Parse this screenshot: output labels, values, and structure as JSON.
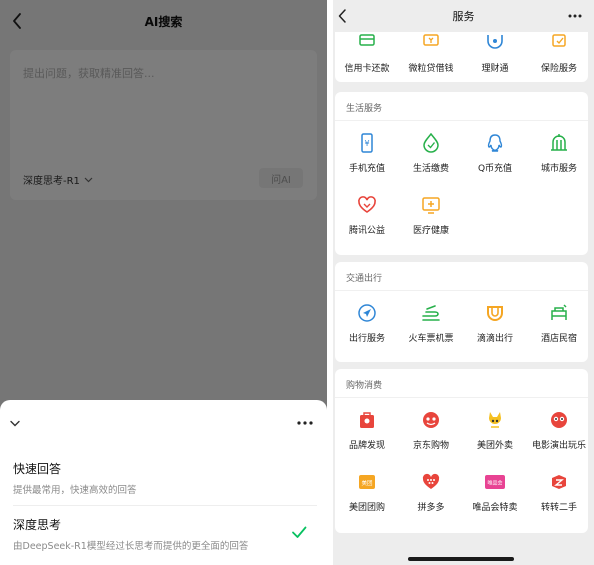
{
  "left": {
    "title": "AI搜索",
    "input_placeholder": "提出问题，获取精准回答...",
    "model_label": "深度思考-R1",
    "ask_button": "问AI",
    "sheet": {
      "options": [
        {
          "title": "快速回答",
          "desc": "提供最常用，快速高效的回答",
          "selected": false
        },
        {
          "title": "深度思考",
          "desc": "由DeepSeek-R1模型经过长思考而提供的更全面的回答",
          "selected": true
        }
      ]
    }
  },
  "right": {
    "title": "服务",
    "top_row": [
      {
        "label": "信用卡还款",
        "icon": "credit-card-icon"
      },
      {
        "label": "微粒贷借钱",
        "icon": "loan-icon"
      },
      {
        "label": "理财通",
        "icon": "wealth-icon"
      },
      {
        "label": "保险服务",
        "icon": "insurance-icon"
      }
    ],
    "sections": [
      {
        "title": "生活服务",
        "items": [
          {
            "label": "手机充值",
            "icon": "phone-recharge-icon"
          },
          {
            "label": "生活缴费",
            "icon": "utility-payment-icon"
          },
          {
            "label": "Q币充值",
            "icon": "qq-coin-icon"
          },
          {
            "label": "城市服务",
            "icon": "city-service-icon"
          },
          {
            "label": "腾讯公益",
            "icon": "charity-icon"
          },
          {
            "label": "医疗健康",
            "icon": "healthcare-icon"
          }
        ]
      },
      {
        "title": "交通出行",
        "items": [
          {
            "label": "出行服务",
            "icon": "travel-service-icon"
          },
          {
            "label": "火车票机票",
            "icon": "train-plane-icon"
          },
          {
            "label": "滴滴出行",
            "icon": "didi-icon"
          },
          {
            "label": "酒店民宿",
            "icon": "hotel-icon"
          }
        ]
      },
      {
        "title": "购物消费",
        "items": [
          {
            "label": "品牌发现",
            "icon": "brand-discovery-icon"
          },
          {
            "label": "京东购物",
            "icon": "jd-shopping-icon"
          },
          {
            "label": "美团外卖",
            "icon": "meituan-delivery-icon"
          },
          {
            "label": "电影演出玩乐",
            "icon": "movie-show-icon"
          },
          {
            "label": "美团团购",
            "icon": "meituan-group-icon",
            "badge": "美团"
          },
          {
            "label": "拼多多",
            "icon": "pinduoduo-icon"
          },
          {
            "label": "唯品会特卖",
            "icon": "vipshop-icon",
            "badge": "唯品会"
          },
          {
            "label": "转转二手",
            "icon": "zhuanzhuan-icon"
          }
        ]
      }
    ]
  },
  "colors": {
    "blue": "#2f86d6",
    "green": "#27b04a",
    "orange": "#f5a623",
    "red": "#e8453c",
    "check_green": "#07c160"
  }
}
